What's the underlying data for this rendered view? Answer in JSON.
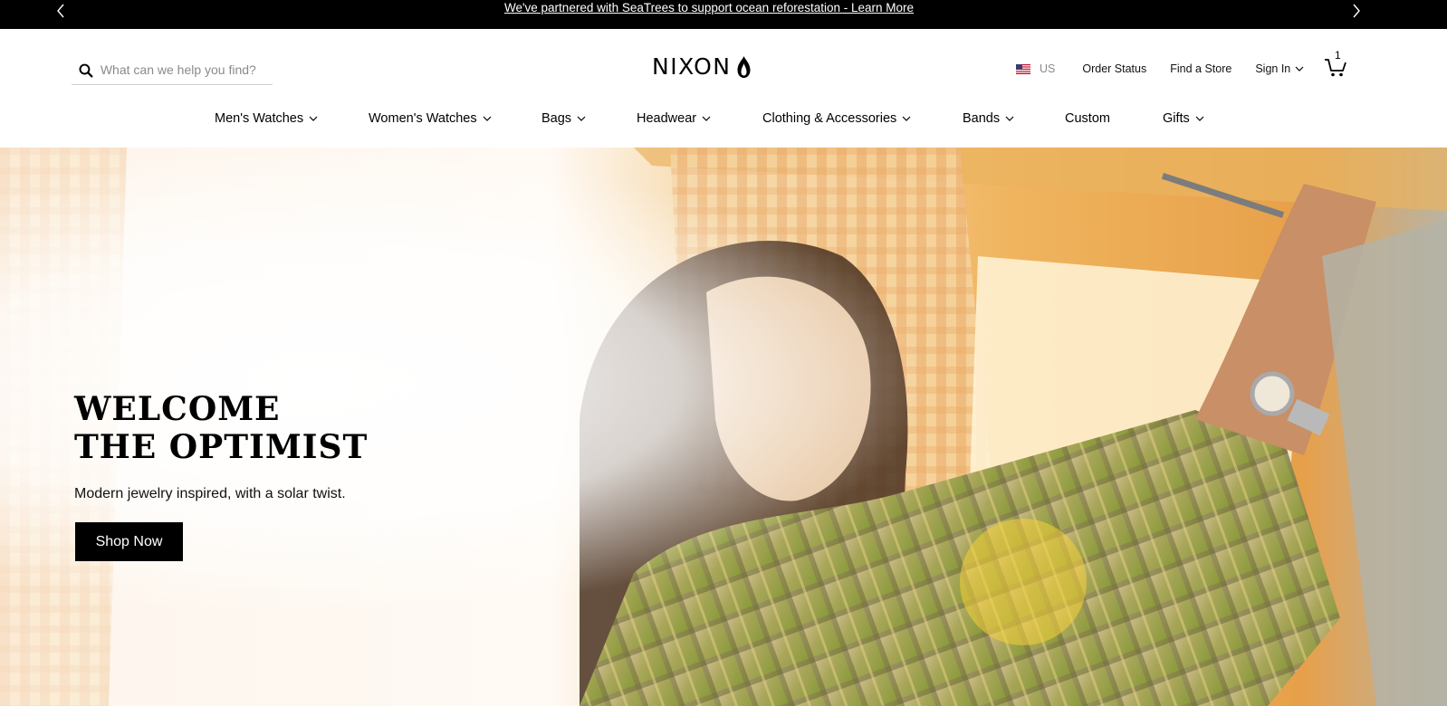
{
  "announcement": {
    "text": "We've partnered with SeaTrees to support ocean reforestation - Learn More"
  },
  "search": {
    "placeholder": "What can we help you find?"
  },
  "logo": {
    "text": "NIXON"
  },
  "utility": {
    "locale": "US",
    "order_status": "Order Status",
    "find_store": "Find a Store",
    "sign_in": "Sign In",
    "cart_count": "1"
  },
  "nav": {
    "items": [
      {
        "label": "Men's Watches",
        "has_dropdown": true
      },
      {
        "label": "Women's Watches",
        "has_dropdown": true
      },
      {
        "label": "Bags",
        "has_dropdown": true
      },
      {
        "label": "Headwear",
        "has_dropdown": true
      },
      {
        "label": "Clothing & Accessories",
        "has_dropdown": true
      },
      {
        "label": "Bands",
        "has_dropdown": true
      },
      {
        "label": "Custom",
        "has_dropdown": false
      },
      {
        "label": "Gifts",
        "has_dropdown": true
      }
    ]
  },
  "hero": {
    "headline_line1": "WELCOME",
    "headline_line2": "THE OPTIMIST",
    "subtitle": "Modern jewelry inspired, with a solar twist.",
    "cta": "Shop Now"
  },
  "colors": {
    "topbar_bg": "#000000",
    "cta_bg": "#000000",
    "text": "#000000"
  }
}
